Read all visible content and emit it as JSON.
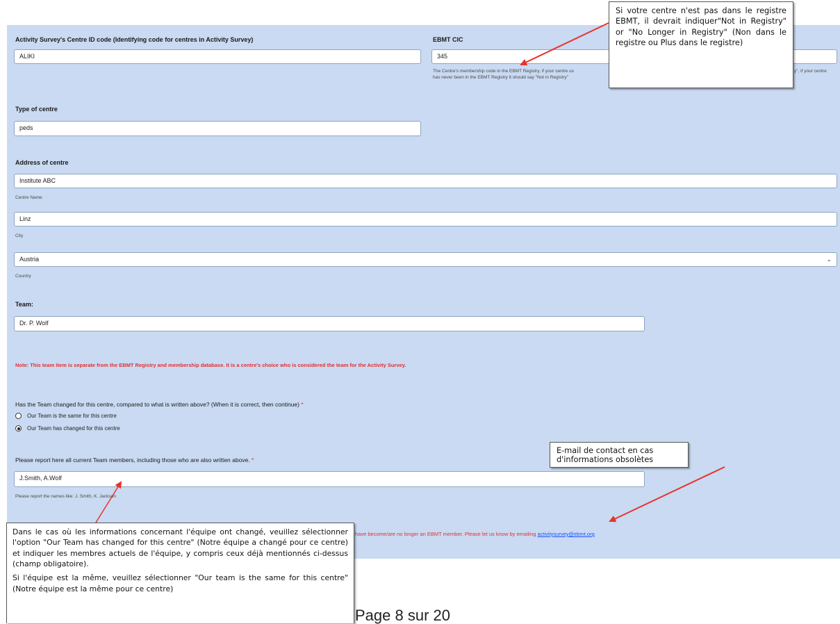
{
  "form": {
    "activity_id_label": "Activity Survey's Centre ID code (Identifying code for centres in Activity Survey)",
    "activity_id_value": "ALIKI",
    "ebmt_cic_label": "EBMT CIC",
    "ebmt_cic_value": "345",
    "ebmt_cic_hint_line1": "The Centre's membership code in the EBMT Registry, if your centre us",
    "ebmt_cic_hint_line1_tail": "y\", if your centre",
    "ebmt_cic_hint_line2": "has never been in the EBMT Registry it should say \"Not in Registry\"",
    "type_label": "Type of centre",
    "type_value": "peds",
    "address_label": "Address of centre",
    "centre_name_value": "Institute ABC",
    "centre_name_hint": "Centre Name",
    "city_value": "Linz",
    "city_hint": "City",
    "country_value": "Austria",
    "country_hint": "Country",
    "team_label": "Team:",
    "team_value": "Dr. P. Wolf",
    "note_text": "Note: This team item is separate from the EBMT Registry and membership database. It is a centre's choice who is considered the team for the Activity Survey.",
    "team_changed_question": "Has the Team changed for this centre, compared to what is written above? (When it is correct, then continue)",
    "required_mark": "*",
    "radio_same": "Our Team is the same for this centre",
    "radio_changed": "Our Team has changed for this centre",
    "report_label": "Please report here all current Team members, including those who are also written above.",
    "report_value": "J.Smith, A.Wolf",
    "report_hint": "Please report the names like: J. Smith, K. Jackson",
    "bottom_text": "have become/are no longer an EBMT member. Please let us know by emailing",
    "bottom_email": "activitysurvey@ebmt.org"
  },
  "callouts": {
    "registry": "Si votre centre n'est pas dans le registre EBMT, il devrait indiquer\"Not in Registry\" or \"No Longer in Registry\" (Non dans le registre ou Plus dans le registre)",
    "email": "E-mail de contact en cas d'informations obsolètes",
    "team_p1": "Dans le cas où les informations concernant l'équipe ont changé, veuillez sélectionner l'option \"Our Team has changed for this centre\" (Notre équipe a changé pour ce centre) et indiquer les membres actuels de l'équipe, y compris ceux déjà mentionnés ci-dessus (champ obligatoire).",
    "team_p2": "Si l'équipe est la même, veuillez sélectionner \"Our team is the same for this centre\"(Notre équipe est la même pour ce centre)"
  },
  "footer": {
    "page": "Page 8 sur 20"
  },
  "colors": {
    "panel": "#c9daf2",
    "note_red": "#e03131",
    "arrow_red": "#e8322a",
    "link_blue": "#1a53ff"
  }
}
